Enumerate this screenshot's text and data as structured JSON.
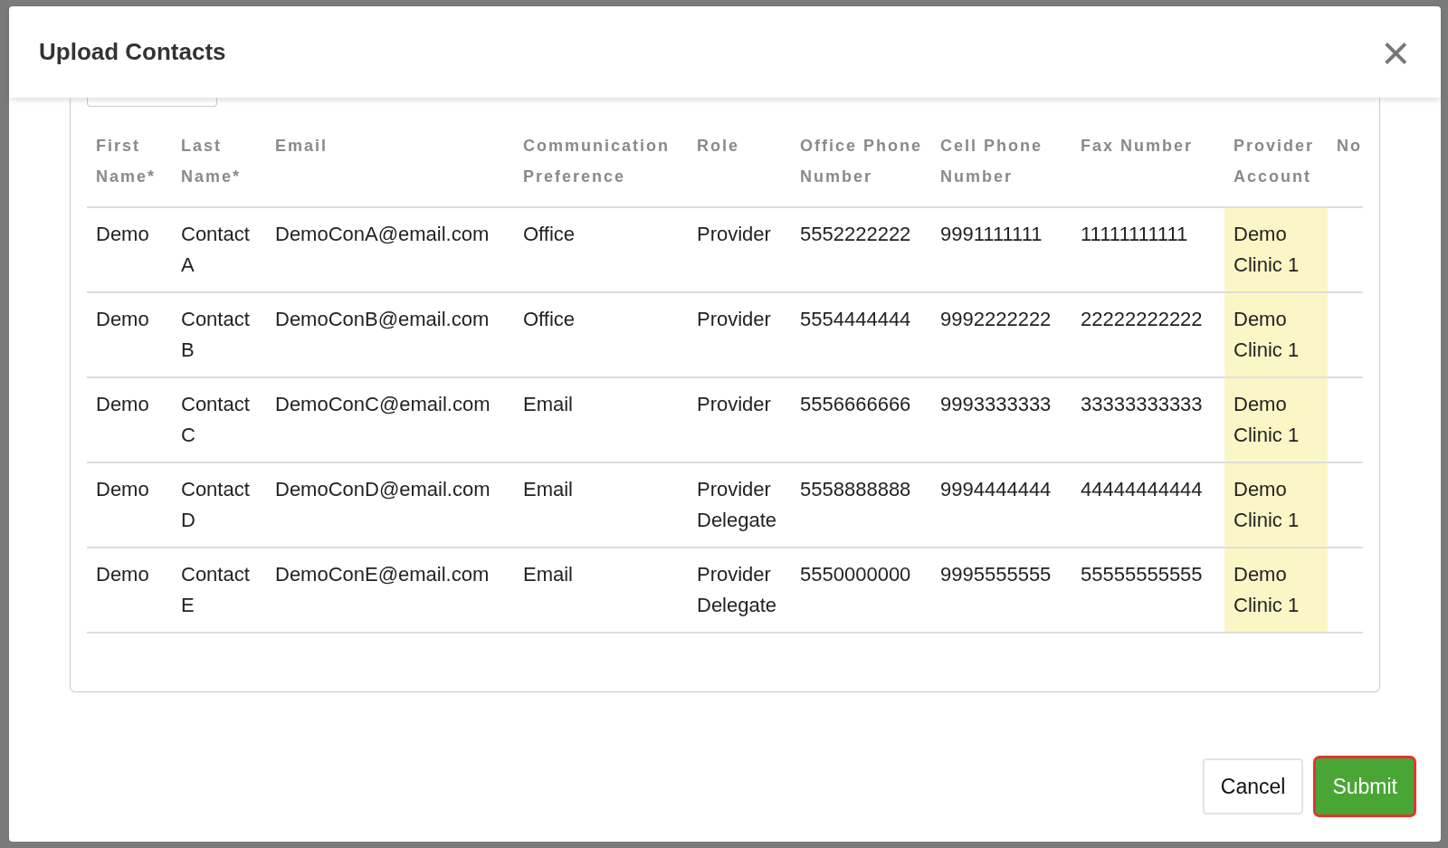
{
  "dialog": {
    "title": "Upload Contacts",
    "close_icon": "×"
  },
  "table": {
    "columns": [
      "First Name*",
      "Last Name*",
      "Email",
      "Communication Preference",
      "Role",
      "Office Phone Number",
      "Cell Phone Number",
      "Fax Number",
      "Provider Account",
      "No"
    ],
    "rows": [
      {
        "cells": [
          "Demo",
          "Contact A",
          "DemoConA@email.com",
          "Office",
          "Provider",
          "5552222222",
          "9991111111",
          "11111111111",
          "Demo Clinic 1"
        ],
        "account_highlighted": true
      },
      {
        "cells": [
          "Demo",
          "Contact B",
          "DemoConB@email.com",
          "Office",
          "Provider",
          "5554444444",
          "9992222222",
          "22222222222",
          "Demo Clinic 1"
        ],
        "account_highlighted": true
      },
      {
        "cells": [
          "Demo",
          "Contact C",
          "DemoConC@email.com",
          "Email",
          "Provider",
          "5556666666",
          "9993333333",
          "33333333333",
          "Demo Clinic 1"
        ],
        "account_highlighted": true
      },
      {
        "cells": [
          "Demo",
          "Contact D",
          "DemoConD@email.com",
          "Email",
          "Provider Delegate",
          "5558888888",
          "9994444444",
          "44444444444",
          "Demo Clinic 1"
        ],
        "account_highlighted": true
      },
      {
        "cells": [
          "Demo",
          "Contact E",
          "DemoConE@email.com",
          "Email",
          "Provider Delegate",
          "5550000000",
          "9995555555",
          "55555555555",
          "Demo Clinic 1"
        ],
        "account_highlighted": true
      }
    ]
  },
  "buttons": [
    {
      "label": "Cancel",
      "kind": "secondary",
      "focused": false
    },
    {
      "label": "Submit",
      "kind": "primary",
      "focused": true
    }
  ]
}
